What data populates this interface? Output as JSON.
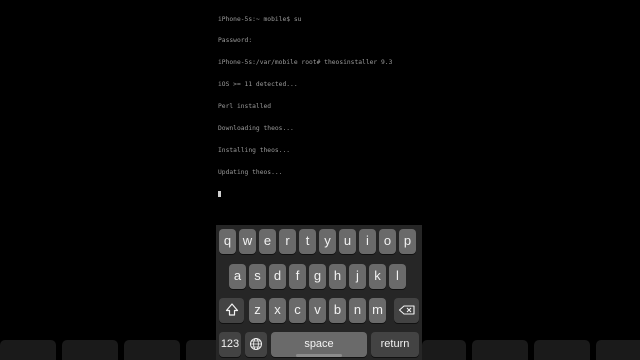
{
  "terminal": {
    "lines": [
      "iPhone-5s:~ mobile$ su",
      "Password:",
      "iPhone-5s:/var/mobile root# theosinstaller 9.3",
      "iOS >= 11 detected...",
      "Perl installed",
      "Downloading theos...",
      "Installing theos...",
      "Updating theos..."
    ]
  },
  "keyboard": {
    "row1": [
      "q",
      "w",
      "e",
      "r",
      "t",
      "y",
      "u",
      "i",
      "o",
      "p"
    ],
    "row2": [
      "a",
      "s",
      "d",
      "f",
      "g",
      "h",
      "j",
      "k",
      "l"
    ],
    "row3": [
      "z",
      "x",
      "c",
      "v",
      "b",
      "n",
      "m"
    ],
    "numbers_label": "123",
    "space_label": "space",
    "return_label": "return",
    "icons": {
      "shift": "shift-icon",
      "delete": "delete-icon",
      "globe": "globe-icon"
    },
    "colors": {
      "key": "#6a6a6a",
      "special_key": "#434343",
      "background": "#262626"
    }
  }
}
